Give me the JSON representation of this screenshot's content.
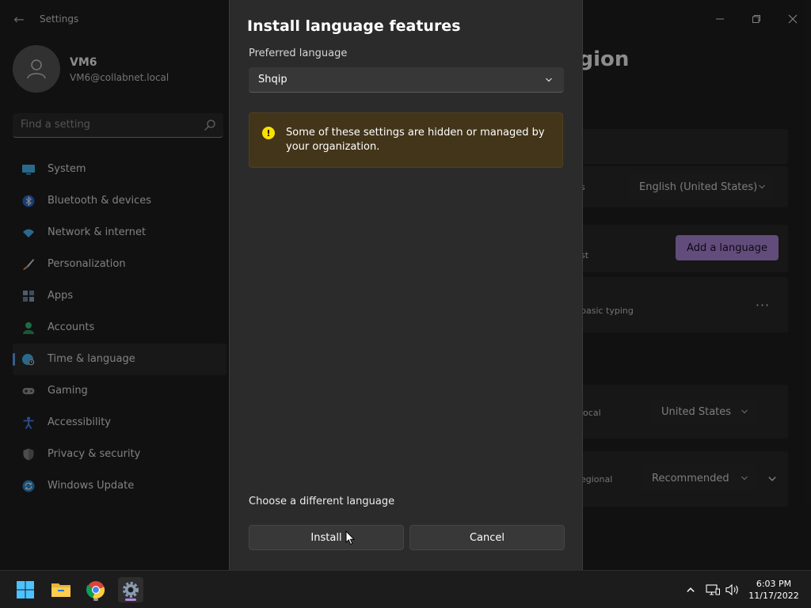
{
  "window": {
    "app_title": "Settings",
    "back_label": "←"
  },
  "profile": {
    "name": "VM6",
    "email": "VM6@collabnet.local"
  },
  "search": {
    "placeholder": "Find a setting"
  },
  "sidebar": {
    "items": [
      {
        "label": "System",
        "icon": "monitor-icon",
        "color": "#4cc2ff"
      },
      {
        "label": "Bluetooth & devices",
        "icon": "bluetooth-icon",
        "color": "#4c8dff"
      },
      {
        "label": "Network & internet",
        "icon": "wifi-icon",
        "color": "#4cc2ff"
      },
      {
        "label": "Personalization",
        "icon": "brush-icon",
        "color": "#e8a06a"
      },
      {
        "label": "Apps",
        "icon": "apps-icon",
        "color": "#8fa9c6"
      },
      {
        "label": "Accounts",
        "icon": "person-icon",
        "color": "#3bbf7a"
      },
      {
        "label": "Time & language",
        "icon": "globe-clock-icon",
        "color": "#4cc2ff",
        "active": true
      },
      {
        "label": "Gaming",
        "icon": "gamepad-icon",
        "color": "#9a9a9a"
      },
      {
        "label": "Accessibility",
        "icon": "accessibility-icon",
        "color": "#4c8dff"
      },
      {
        "label": "Privacy & security",
        "icon": "shield-icon",
        "color": "#9a9a9a"
      },
      {
        "label": "Windows Update",
        "icon": "update-icon",
        "color": "#4cc2ff"
      }
    ]
  },
  "background_page": {
    "heading": "region",
    "display_language_value": "English (United States)",
    "row_suffix_1": "s",
    "row_suffix_2": "st",
    "add_language_label": "Add a language",
    "language_row_text": "basic typing",
    "more_label": "···",
    "country_label": "local",
    "country_value": "United States",
    "regional_label": "egional",
    "regional_value": "Recommended"
  },
  "dialog": {
    "title": "Install language features",
    "preferred_language_label": "Preferred language",
    "preferred_language_value": "Shqip",
    "warning_text": "Some of these settings are hidden or managed by your organization.",
    "warning_symbol": "!",
    "different_language_link": "Choose a different language",
    "install_label": "Install",
    "cancel_label": "Cancel"
  },
  "taskbar": {
    "apps": [
      "start-icon",
      "file-explorer-icon",
      "chrome-icon",
      "settings-app-icon"
    ],
    "time": "6:03 PM",
    "date": "11/17/2022"
  },
  "colors": {
    "accent": "#b38ae0",
    "warning_bg": "#433519",
    "warning_icon": "#fce100"
  }
}
